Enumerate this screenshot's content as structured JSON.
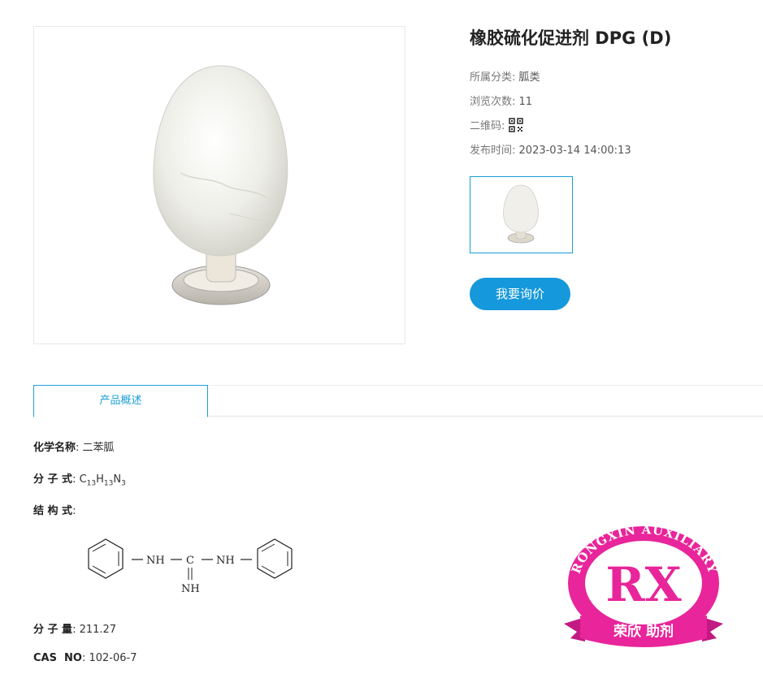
{
  "product": {
    "title": "橡胶硫化促进剂 DPG (D)",
    "category_label": "所属分类:",
    "category_value": "胍类",
    "views_label": "浏览次数:",
    "views_value": "11",
    "qr_label": "二维码:",
    "date_label": "发布时间:",
    "date_value": "2023-03-14 14:00:13",
    "inquiry_button": "我要询价"
  },
  "tabs": [
    {
      "label": "产品概述"
    }
  ],
  "details": {
    "chem_name_label": "化学名称",
    "chem_name_value": ": 二苯胍",
    "formula_label": "分 子 式",
    "formula_c": "C",
    "formula_c_n": "13",
    "formula_h": "H",
    "formula_h_n": "13",
    "formula_n": "N",
    "formula_n_n": "3",
    "structure_label": "结 构 式",
    "structure_nh1": "NH",
    "structure_c": "C",
    "structure_nh2": "NH",
    "structure_nh3": "NH",
    "mw_label": "分 子 量",
    "mw_value": ": 211.27",
    "cas_label": "CAS  NO",
    "cas_value": ": 102-06-7"
  },
  "logo": {
    "top_arc_text": "RONGXIN AUXILIARY",
    "main_letters": "RX",
    "ribbon_text": "荣欣 助剂",
    "color": "#e8259a"
  },
  "colors": {
    "accent": "#1598dc",
    "tab_border": "#1a9fd6"
  }
}
